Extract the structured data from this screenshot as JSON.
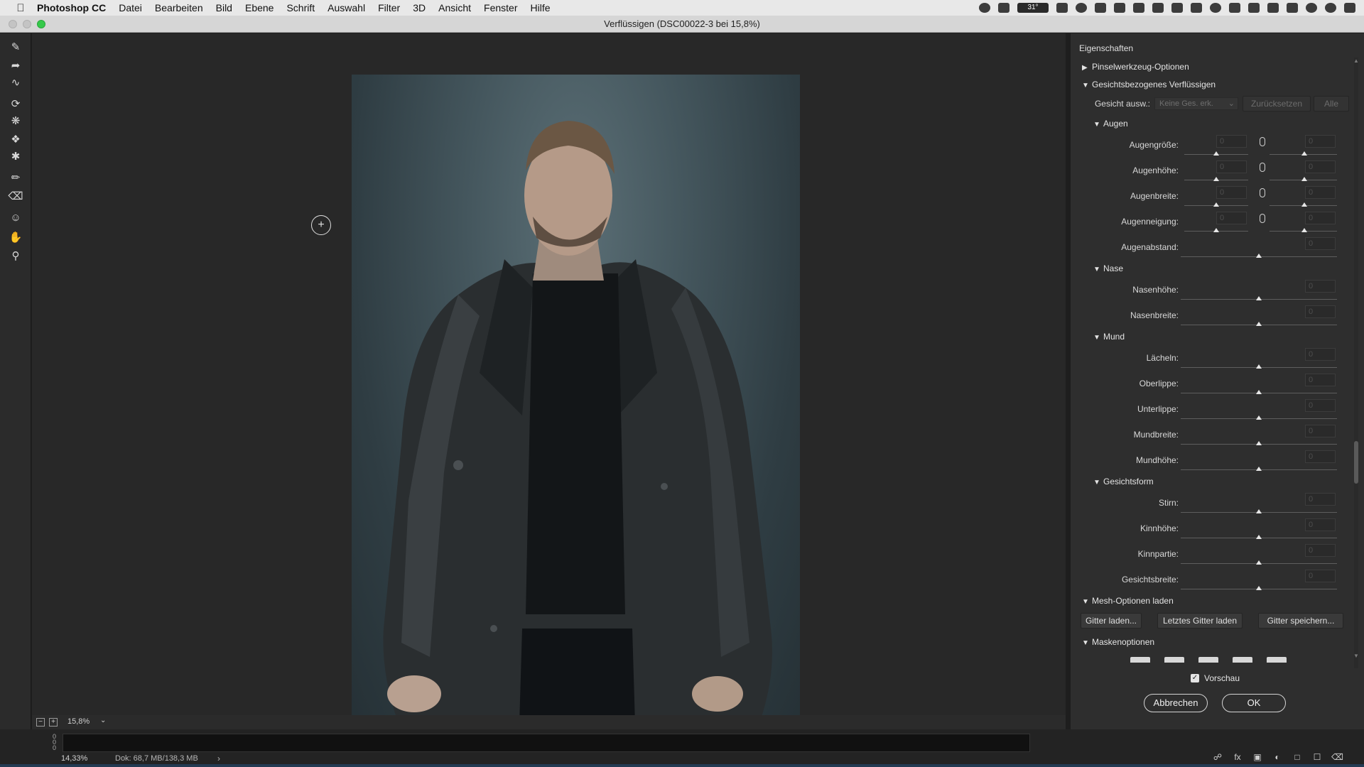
{
  "menubar": {
    "app": "Photoshop CC",
    "items": [
      "Datei",
      "Bearbeiten",
      "Bild",
      "Ebene",
      "Schrift",
      "Auswahl",
      "Filter",
      "3D",
      "Ansicht",
      "Fenster",
      "Hilfe"
    ],
    "temperature": "31°"
  },
  "window": {
    "title": "Verflüssigen (DSC00022-3 bei 15,8%)"
  },
  "canvas": {
    "zoom": "15,8%"
  },
  "status": {
    "zoom_pct": "14,33%",
    "doc_size": "Dok: 68,7 MB/138,3 MB",
    "ruler_zeros": "0\n0\n0"
  },
  "panel": {
    "title": "Eigenschaften",
    "brush_options": "Pinselwerkzeug-Optionen",
    "face_aware": "Gesichtsbezogenes Verflüssigen",
    "face_select_label": "Gesicht ausw.:",
    "face_select_value": "Keine Ges. erk.",
    "reset": "Zurücksetzen",
    "all": "Alle",
    "eyes": {
      "title": "Augen",
      "rows": [
        {
          "label": "Augengröße:",
          "left": "0",
          "right": "0"
        },
        {
          "label": "Augenhöhe:",
          "left": "0",
          "right": "0"
        },
        {
          "label": "Augenbreite:",
          "left": "0",
          "right": "0"
        },
        {
          "label": "Augenneigung:",
          "left": "0",
          "right": "0"
        }
      ],
      "distance": {
        "label": "Augenabstand:",
        "value": "0"
      }
    },
    "nose": {
      "title": "Nase",
      "rows": [
        {
          "label": "Nasenhöhe:",
          "value": "0"
        },
        {
          "label": "Nasenbreite:",
          "value": "0"
        }
      ]
    },
    "mouth": {
      "title": "Mund",
      "rows": [
        {
          "label": "Lächeln:",
          "value": "0"
        },
        {
          "label": "Oberlippe:",
          "value": "0"
        },
        {
          "label": "Unterlippe:",
          "value": "0"
        },
        {
          "label": "Mundbreite:",
          "value": "0"
        },
        {
          "label": "Mundhöhe:",
          "value": "0"
        }
      ]
    },
    "face_shape": {
      "title": "Gesichtsform",
      "rows": [
        {
          "label": "Stirn:",
          "value": "0"
        },
        {
          "label": "Kinnhöhe:",
          "value": "0"
        },
        {
          "label": "Kinnpartie:",
          "value": "0"
        },
        {
          "label": "Gesichtsbreite:",
          "value": "0"
        }
      ]
    },
    "mesh": {
      "title": "Mesh-Optionen laden",
      "load": "Gitter laden...",
      "last": "Letztes Gitter laden",
      "save": "Gitter speichern..."
    },
    "mask_options": "Maskenoptionen",
    "preview": "Vorschau",
    "cancel": "Abbrechen",
    "ok": "OK"
  }
}
